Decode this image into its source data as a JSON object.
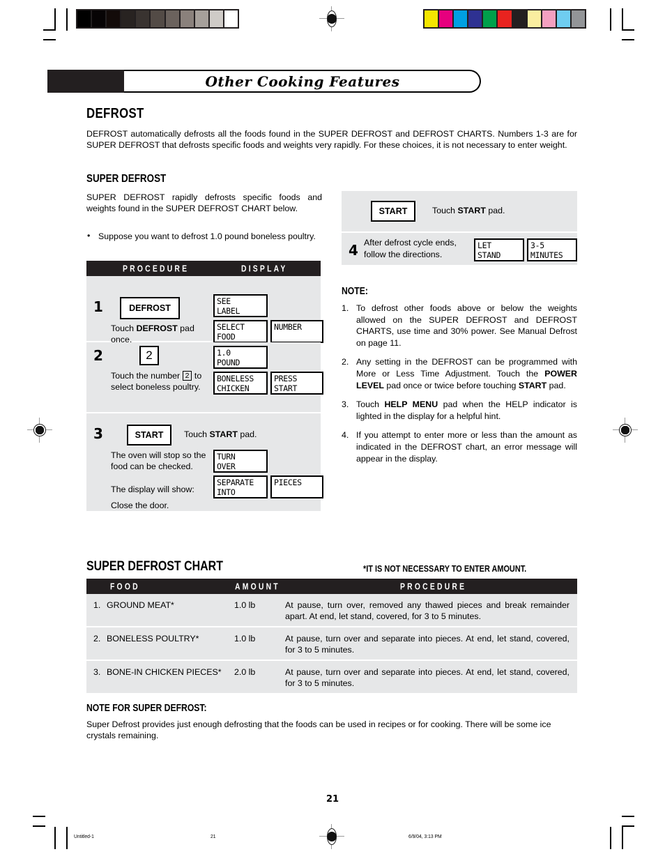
{
  "header": {
    "banner_title": "Other Cooking Features"
  },
  "section": {
    "title": "DEFROST",
    "intro": "DEFROST automatically defrosts all the foods found in the SUPER DEFROST and DEFROST CHARTS. Numbers 1-3 are for SUPER DEFROST that defrosts specific foods and weights very rapidly. For these choices, it is not necessary to enter weight.",
    "subtitle": "SUPER DEFROST",
    "sub_intro": "SUPER DEFROST rapidly defrosts specific foods and weights found in the SUPER DEFROST CHART below.",
    "bullet": "Suppose you want to defrost 1.0 pound boneless poultry."
  },
  "procedure_table": {
    "col_procedure": "PROCEDURE",
    "col_display": "DISPLAY",
    "steps": [
      {
        "num": "1",
        "pad_label": "DEFROST",
        "caption": "Touch DEFROST pad once.",
        "caption_pre": "Touch ",
        "caption_bold": "DEFROST",
        "caption_post": " pad once.",
        "displays": [
          "SEE\nLABEL",
          "SELECT\nFOOD",
          "NUMBER"
        ]
      },
      {
        "num": "2",
        "numpad_label": "2",
        "caption_pre": "Touch the number ",
        "caption_box": "2",
        "caption_post": " to select boneless poultry.",
        "displays": [
          "1.0\nPOUND",
          "BONELESS\nCHICKEN",
          "PRESS\nSTART"
        ]
      },
      {
        "num": "3",
        "pad_label": "START",
        "caption_pre": "Touch ",
        "caption_bold": "START",
        "caption_post": " pad.",
        "caption2": "The oven will stop so the food can be checked.",
        "caption3": "The display will show:",
        "caption4": "Close the door.",
        "displays": [
          "TURN\nOVER",
          "SEPARATE\nINTO",
          "PIECES"
        ]
      }
    ]
  },
  "procedure_table_right": {
    "steps": [
      {
        "pad_label": "START",
        "caption_pre": "Touch ",
        "caption_bold": "START",
        "caption_post": " pad."
      },
      {
        "num": "4",
        "caption_line1": "After defrost cycle ends,",
        "caption_line2": "follow the directions.",
        "displays": [
          "LET\nSTAND",
          "3-5\nMINUTES"
        ]
      }
    ]
  },
  "note": {
    "heading": "NOTE:",
    "items": [
      {
        "num": "1.",
        "parts": [
          {
            "t": "To defrost other foods above or below the weights allowed on the SUPER DEFROST and  DEFROST CHARTS, use time and 30% power. See Manual Defrost on page 11.",
            "b": false
          }
        ]
      },
      {
        "num": "2.",
        "parts": [
          {
            "t": "Any setting in the DEFROST can be programmed with More or Less Time Adjustment. Touch the ",
            "b": false
          },
          {
            "t": "POWER LEVEL",
            "b": true
          },
          {
            "t": " pad once or twice before touching ",
            "b": false
          },
          {
            "t": "START",
            "b": true
          },
          {
            "t": " pad.",
            "b": false
          }
        ]
      },
      {
        "num": "3.",
        "parts": [
          {
            "t": "Touch ",
            "b": false
          },
          {
            "t": "HELP MENU",
            "b": true
          },
          {
            "t": " pad when the HELP indicator is lighted in the display for a helpful hint.",
            "b": false
          }
        ]
      },
      {
        "num": "4.",
        "parts": [
          {
            "t": "If you attempt to enter more or less than the amount as indicated in the DEFROST chart, an error message will appear in the display.",
            "b": false
          }
        ]
      }
    ]
  },
  "chart": {
    "title": "SUPER DEFROST CHART",
    "footnote": "*IT IS NOT NECESSARY TO ENTER AMOUNT.",
    "columns": {
      "food": "FOOD",
      "amount": "AMOUNT",
      "procedure": "PROCEDURE"
    },
    "rows": [
      {
        "index": "1.",
        "food": "GROUND MEAT*",
        "amount": "1.0 lb",
        "procedure": "At pause, turn over, removed any thawed pieces and break remainder apart. At end, let stand, covered, for 3 to 5 minutes."
      },
      {
        "index": "2.",
        "food": "BONELESS POULTRY*",
        "amount": "1.0 lb",
        "procedure": "At pause, turn over and separate into pieces. At end, let stand, covered, for 3 to 5 minutes."
      },
      {
        "index": "3.",
        "food": "BONE-IN CHICKEN PIECES*",
        "amount": "2.0 lb",
        "procedure": "At pause, turn over and separate into pieces. At end, let stand, covered, for 3 to 5 minutes."
      }
    ]
  },
  "chart_note": {
    "heading": "NOTE FOR SUPER DEFROST:",
    "body": "Super Defrost provides just enough defrosting that the foods can be used in recipes or for cooking. There will be some ice crystals remaining."
  },
  "footer": {
    "page_number": "21",
    "file_name": "Untitled-1",
    "sheet_number": "21",
    "timestamp": "6/9/04, 3:13 PM"
  },
  "print_marks": {
    "grayscale_swatches": [
      "#000000",
      "#070405",
      "#130b09",
      "#282321",
      "#393330",
      "#534b46",
      "#6b625d",
      "#8a817c",
      "#a6a09b",
      "#cfcbc7",
      "#ffffff"
    ],
    "color_swatches": [
      "#f5e600",
      "#e6007e",
      "#00a0e3",
      "#2e3192",
      "#00a04b",
      "#e8231f",
      "#231f20",
      "#faeea0",
      "#f4a0c0",
      "#6fcdf0",
      "#939598"
    ]
  }
}
